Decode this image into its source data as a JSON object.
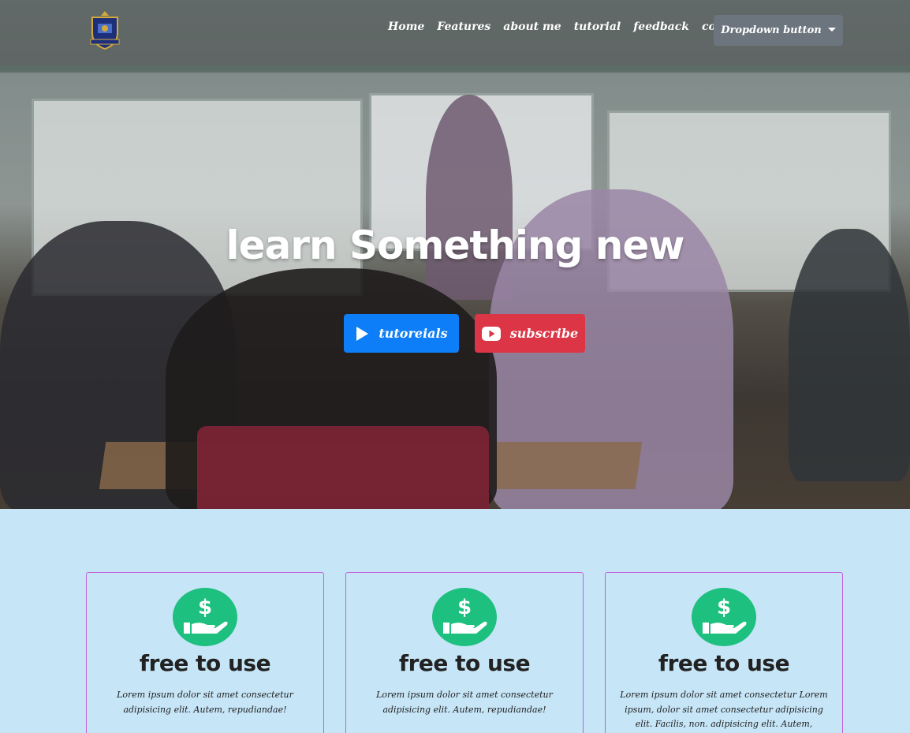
{
  "navbar": {
    "links": [
      "Home",
      "Features",
      "about me",
      "tutorial",
      "feedback",
      "contact"
    ],
    "dropdown_label": "Dropdown button"
  },
  "hero": {
    "title": "learn Something new",
    "buttons": {
      "tutorials_label": "tutoreials",
      "subscribe_label": "subscribe"
    }
  },
  "cards": [
    {
      "icon": "money-hand-icon",
      "title": "free to use",
      "text": "Lorem ipsum dolor sit amet consectetur adipisicing elit. Autem, repudiandae!"
    },
    {
      "icon": "money-hand-icon",
      "title": "free to use",
      "text": "Lorem ipsum dolor sit amet consectetur adipisicing elit. Autem, repudiandae!"
    },
    {
      "icon": "money-hand-icon",
      "title": "free to use",
      "text": "Lorem ipsum dolor sit amet consectetur Lorem ipsum, dolor sit amet consectetur adipisicing elit. Facilis, non. adipisicing elit. Autem, repudiandae!"
    }
  ],
  "colors": {
    "primary": "#0d7ef8",
    "danger": "#dc3545",
    "secondary": "#6c757d",
    "icon_green": "#1dc07e",
    "section_bg": "#c6e5f7",
    "card_border": "#c060d8"
  }
}
